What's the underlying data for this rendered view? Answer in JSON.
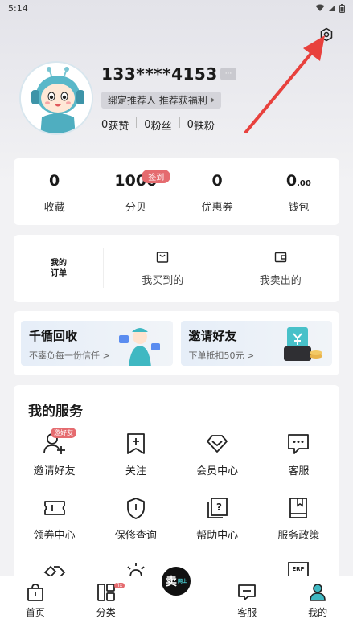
{
  "status_bar": {
    "time": "5:14"
  },
  "profile": {
    "phone": "133****4153",
    "edit_label": "···",
    "bind_referrer": "绑定推荐人 推荐获福利",
    "stats": [
      {
        "value": "0",
        "label": "获赞"
      },
      {
        "value": "0",
        "label": "粉丝"
      },
      {
        "value": "0",
        "label": "铁粉"
      }
    ]
  },
  "assets": [
    {
      "value": "0",
      "label": "收藏"
    },
    {
      "value": "1000",
      "label": "分贝",
      "badge": "签到"
    },
    {
      "value": "0",
      "label": "优惠券"
    },
    {
      "value": "0",
      "value_small": ".00",
      "label": "钱包"
    }
  ],
  "orders": {
    "title": "我的订单",
    "items": [
      {
        "label": "我买到的",
        "icon": "bag-icon"
      },
      {
        "label": "我卖出的",
        "icon": "wallet-icon"
      }
    ]
  },
  "promos": [
    {
      "title": "千循回收",
      "subtitle": "不辜负每一份信任 >"
    },
    {
      "title": "邀请好友",
      "subtitle": "下单抵扣50元 >"
    }
  ],
  "services": {
    "title": "我的服务",
    "items": [
      {
        "label": "邀请好友",
        "icon": "add-user-icon",
        "badge": "邀好友"
      },
      {
        "label": "关注",
        "icon": "bookmark-plus-icon"
      },
      {
        "label": "会员中心",
        "icon": "diamond-icon"
      },
      {
        "label": "客服",
        "icon": "chat-icon"
      },
      {
        "label": "领券中心",
        "icon": "ticket-icon"
      },
      {
        "label": "保修查询",
        "icon": "shield-icon"
      },
      {
        "label": "帮助中心",
        "icon": "help-doc-icon"
      },
      {
        "label": "服务政策",
        "icon": "policy-book-icon"
      },
      {
        "label": "",
        "icon": "handshake-icon"
      },
      {
        "label": "",
        "icon": "sun-icon"
      },
      {
        "label": "",
        "icon": "blank"
      },
      {
        "label": "",
        "icon": "erp-icon"
      }
    ]
  },
  "tabbar": {
    "items": [
      {
        "label": "首页",
        "icon": "home-bag-icon"
      },
      {
        "label": "分类",
        "icon": "category-icon",
        "badge": "fix"
      },
      {
        "label": "",
        "icon": "sell-center-icon",
        "center_text": "卖",
        "center_mini": "网上"
      },
      {
        "label": "客服",
        "icon": "chat-icon"
      },
      {
        "label": "我的",
        "icon": "profile-icon"
      }
    ]
  },
  "colors": {
    "accent_red": "#e56b6f",
    "teal": "#3fb8c2"
  }
}
